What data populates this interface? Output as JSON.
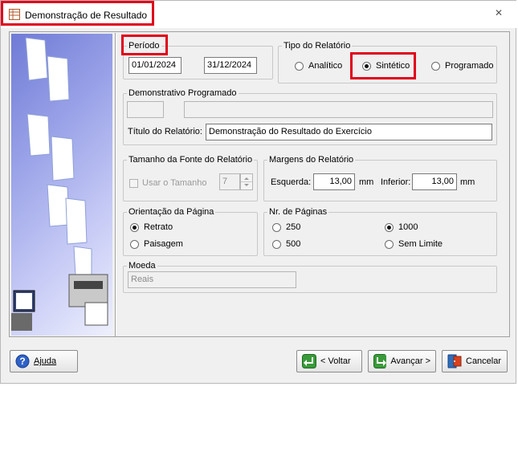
{
  "window": {
    "title": "Demonstração de Resultado",
    "close_glyph": "✕"
  },
  "periodo": {
    "label": "Período",
    "start": "01/01/2024",
    "end": "31/12/2024"
  },
  "tipo_relatorio": {
    "label": "Tipo do Relatório",
    "options": [
      "Analítico",
      "Sintético",
      "Programado"
    ],
    "selected": "Sintético"
  },
  "demonstrativo": {
    "label": "Demonstrativo Programado",
    "code": "",
    "name": "",
    "titulo_label": "Título do Relatório:",
    "titulo_value": "Demonstração do Resultado do Exercício"
  },
  "fonte": {
    "label": "Tamanho da Fonte do Relatório",
    "usar_label": "Usar o Tamanho",
    "usar_checked": false,
    "size": "7"
  },
  "margens": {
    "label": "Margens do Relatório",
    "esquerda_label": "Esquerda:",
    "esquerda_value": "13,00",
    "inferior_label": "Inferior:",
    "inferior_value": "13,00",
    "unit": "mm"
  },
  "orientacao": {
    "label": "Orientação da Página",
    "options": [
      "Retrato",
      "Paisagem"
    ],
    "selected": "Retrato"
  },
  "paginas": {
    "label": "Nr. de Páginas",
    "options": [
      "250",
      "1000",
      "500",
      "Sem Limite"
    ],
    "selected": "1000"
  },
  "moeda": {
    "label": "Moeda",
    "value": "Reais"
  },
  "buttons": {
    "ajuda": "Ajuda",
    "voltar": "< Voltar",
    "avancar": "Avançar >",
    "cancelar": "Cancelar"
  },
  "icons": [
    "report-icon",
    "help-icon",
    "back-icon",
    "forward-icon",
    "cancel-icon"
  ],
  "colors": {
    "highlight": "#e0001a",
    "window_bg": "#f0f0f0",
    "side_panel": "#7f8ae0"
  }
}
